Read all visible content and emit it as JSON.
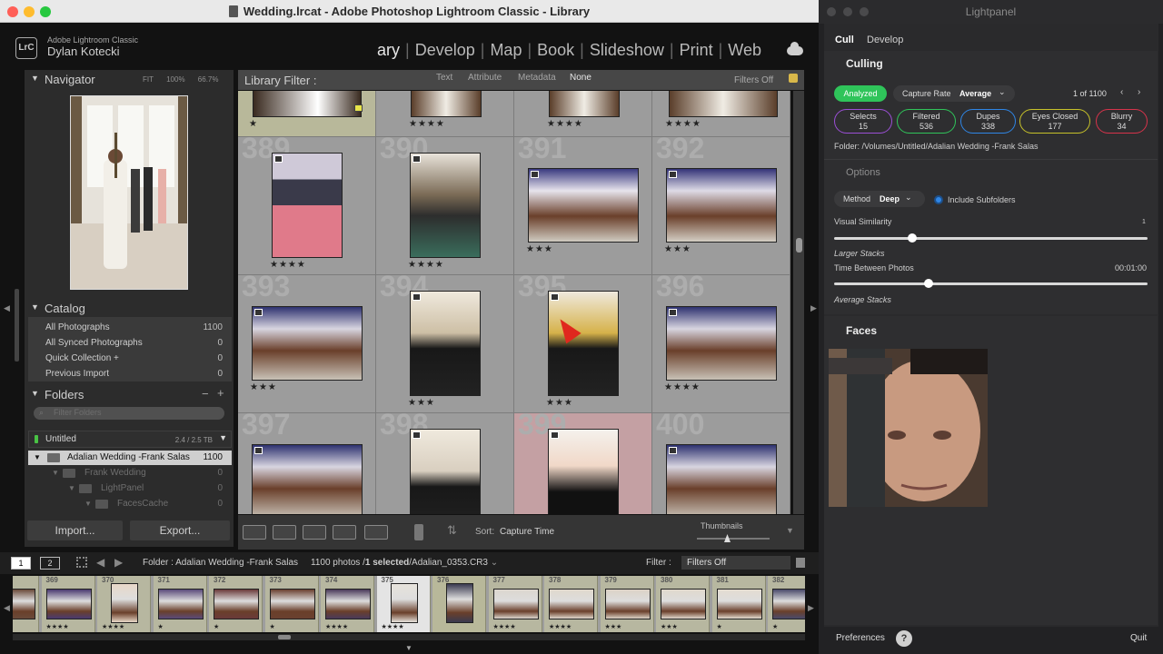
{
  "lightroom": {
    "window_title": "Wedding.lrcat - Adobe Photoshop Lightroom Classic - Library",
    "identity": {
      "logo": "LrC",
      "product": "Adobe Lightroom Classic",
      "user": "Dylan Kotecki"
    },
    "modules": [
      "ary",
      "Develop",
      "Map",
      "Book",
      "Slideshow",
      "Print",
      "Web"
    ],
    "module_separator": "|",
    "navigator": {
      "title": "Navigator",
      "options": [
        "FIT",
        "100%",
        "66.7%"
      ]
    },
    "catalog": {
      "title": "Catalog",
      "items": [
        {
          "label": "All Photographs",
          "count": "1100"
        },
        {
          "label": "All Synced Photographs",
          "count": "0"
        },
        {
          "label": "Quick Collection +",
          "count": "0"
        },
        {
          "label": "Previous Import",
          "count": "0"
        }
      ]
    },
    "folders": {
      "title": "Folders",
      "add": "+",
      "remove": "−",
      "search_placeholder": "Filter Folders",
      "volume": {
        "name": "Untitled",
        "size": "2.4 / 2.5 TB"
      },
      "tree": [
        {
          "name": "Adalian Wedding -Frank Salas",
          "count": "1100"
        },
        {
          "name": "Frank Wedding",
          "count": "0"
        },
        {
          "name": "LightPanel",
          "count": "0"
        },
        {
          "name": "FacesCache",
          "count": "0"
        }
      ]
    },
    "buttons": {
      "import": "Import...",
      "export": "Export..."
    },
    "filter_bar": {
      "title": "Library Filter :",
      "tabs": [
        "Text",
        "Attribute",
        "Metadata",
        "None"
      ],
      "filters_off": "Filters Off"
    },
    "grid": {
      "top_row_stars": [
        "★",
        "★★★★",
        "★★★★",
        "★★★★"
      ],
      "cells": [
        {
          "num": "389",
          "stars": "★★★★"
        },
        {
          "num": "390",
          "stars": "★★★★"
        },
        {
          "num": "391",
          "stars": "★★★"
        },
        {
          "num": "392",
          "stars": "★★★"
        },
        {
          "num": "393",
          "stars": "★★★"
        },
        {
          "num": "394",
          "stars": "★★★"
        },
        {
          "num": "395",
          "stars": "★★★"
        },
        {
          "num": "396",
          "stars": "★★★★"
        },
        {
          "num": "397",
          "stars": ""
        },
        {
          "num": "398",
          "stars": ""
        },
        {
          "num": "399",
          "stars": ""
        },
        {
          "num": "400",
          "stars": ""
        }
      ]
    },
    "toolbar": {
      "sort_label": "Sort:",
      "sort_value": "Capture Time",
      "thumbnails_label": "Thumbnails"
    },
    "filmstrip_header": {
      "page1": "1",
      "page2": "2",
      "source": "Folder : Adalian Wedding -Frank Salas",
      "count": "1100 photos /",
      "selected": "1 selected",
      "file": "/Adalian_0353.CR3",
      "filter_label": "Filter :",
      "filter_value": "Filters Off"
    },
    "filmstrip": [
      {
        "n": "",
        "s": ""
      },
      {
        "n": "369",
        "s": "★★★★"
      },
      {
        "n": "370",
        "s": "★★★★"
      },
      {
        "n": "371",
        "s": "★"
      },
      {
        "n": "372",
        "s": "★"
      },
      {
        "n": "373",
        "s": "★"
      },
      {
        "n": "374",
        "s": "★★★★"
      },
      {
        "n": "375",
        "s": "★★★★"
      },
      {
        "n": "376",
        "s": ""
      },
      {
        "n": "377",
        "s": "★★★★"
      },
      {
        "n": "378",
        "s": "★★★★"
      },
      {
        "n": "379",
        "s": "★★★"
      },
      {
        "n": "380",
        "s": "★★★"
      },
      {
        "n": "381",
        "s": "★"
      },
      {
        "n": "382",
        "s": "★"
      }
    ]
  },
  "lightpanel": {
    "title": "Lightpanel",
    "tabs": [
      "Cull",
      "Develop"
    ],
    "culling": {
      "heading": "Culling",
      "status": "Analyzed",
      "capture_rate_label": "Capture Rate",
      "capture_rate_value": "Average",
      "position": "1 of 1100",
      "chips": [
        {
          "label": "Selects",
          "count": "15",
          "color": "#9b4fd6"
        },
        {
          "label": "Filtered",
          "count": "536",
          "color": "#30c45a"
        },
        {
          "label": "Dupes",
          "count": "338",
          "color": "#2f86e6"
        },
        {
          "label": "Eyes Closed",
          "count": "177",
          "color": "#c7c22a"
        },
        {
          "label": "Blurry",
          "count": "34",
          "color": "#d7334b"
        }
      ],
      "folder": "Folder:  /Volumes/Untitled/Adalian Wedding -Frank Salas",
      "options_title": "Options",
      "method_label": "Method",
      "method_value": "Deep",
      "include_subfolders": "Include Subfolders",
      "visual_similarity_label": "Visual Similarity",
      "visual_similarity_value": "1",
      "visual_similarity_level": 0.25,
      "larger_stacks": "Larger Stacks",
      "time_between_label": "Time Between Photos",
      "time_between_value": "00:01:00",
      "time_between_level": 0.3,
      "average_stacks": "Average Stacks"
    },
    "faces_title": "Faces",
    "footer": {
      "preferences": "Preferences",
      "help": "?",
      "quit": "Quit"
    }
  }
}
